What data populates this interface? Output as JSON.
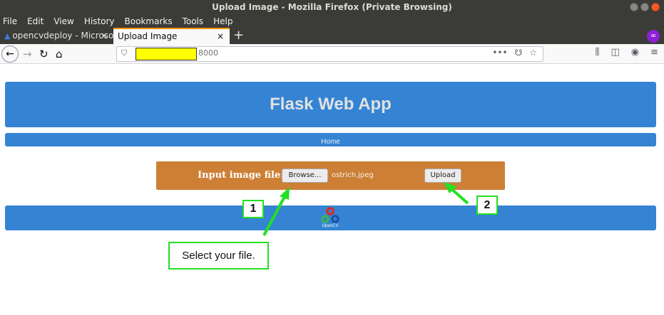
{
  "window": {
    "title": "Upload Image - Mozilla Firefox (Private Browsing)"
  },
  "menu": [
    "File",
    "Edit",
    "View",
    "History",
    "Bookmarks",
    "Tools",
    "Help"
  ],
  "tabs": [
    {
      "label": "opencvdeploy - Microsof",
      "close": "×"
    },
    {
      "label": "Upload Image",
      "close": "×"
    }
  ],
  "newtab_label": "+",
  "navbar": {
    "url_suffix": "8000",
    "more_actions": "•••"
  },
  "page": {
    "title": "Flask Web App",
    "nav_home": "Home",
    "upload_label": "Input image file:",
    "browse_label": "Browse...",
    "file_name": "ostrich.jpeg",
    "upload_button": "Upload",
    "footer_logo_text": "OpenCV"
  },
  "annotations": {
    "step1": "1",
    "step2": "2",
    "note": "Select your file.",
    "color": "#22e022"
  },
  "colors": {
    "header_blue": "#3484d3",
    "upload_orange": "#cd7f35",
    "tab_accent": "#ff9400",
    "private_purple": "#8f1fd6"
  }
}
